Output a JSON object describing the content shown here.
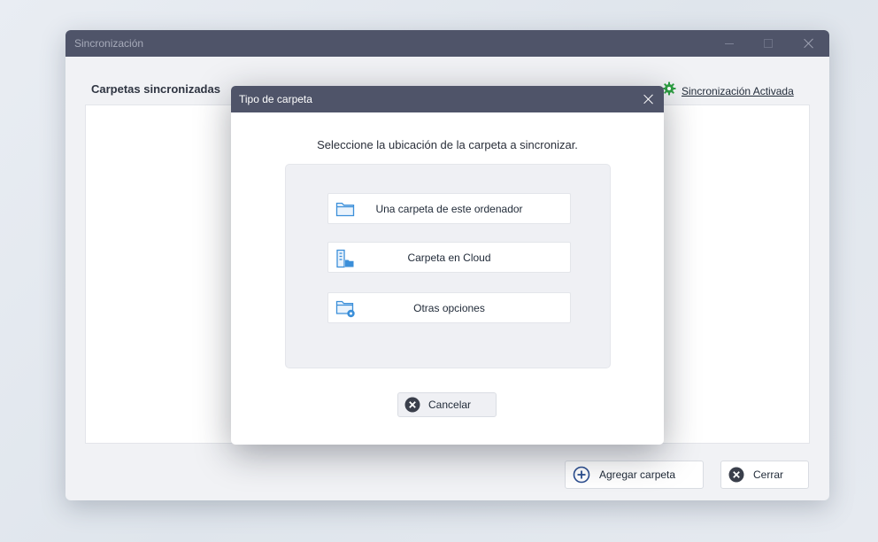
{
  "main_window": {
    "title": "Sincronización",
    "heading": "Carpetas sincronizadas",
    "sync_status": "Sincronización Activada",
    "buttons": {
      "add_folder": "Agregar carpeta",
      "close": "Cerrar"
    }
  },
  "dialog": {
    "title": "Tipo de carpeta",
    "prompt": "Seleccione la ubicación de la carpeta a sincronizar.",
    "options": [
      {
        "label": "Una carpeta de este ordenador",
        "icon": "folder-icon"
      },
      {
        "label": "Carpeta en Cloud",
        "icon": "cloud-folder-icon"
      },
      {
        "label": "Otras opciones",
        "icon": "folder-settings-icon"
      }
    ],
    "cancel_label": "Cancelar"
  },
  "colors": {
    "titlebar": "#4f5469",
    "accent_blue": "#3b8fd9",
    "status_green": "#2ea043",
    "dark_circle": "#3a3f4b"
  }
}
